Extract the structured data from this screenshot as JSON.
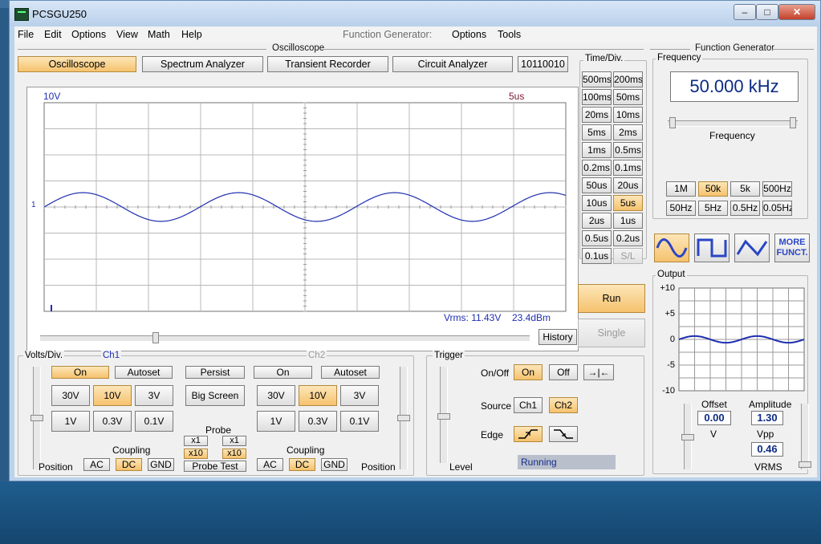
{
  "window": {
    "title": "PCSGU250"
  },
  "menu": {
    "file": "File",
    "edit": "Edit",
    "options": "Options",
    "view": "View",
    "math": "Math",
    "help": "Help",
    "fg_label": "Function Generator:",
    "fg_options": "Options",
    "fg_tools": "Tools"
  },
  "sections": {
    "oscilloscope": "Oscilloscope",
    "function_generator": "Function Generator"
  },
  "modes": {
    "oscilloscope": "Oscilloscope",
    "spectrum": "Spectrum Analyzer",
    "transient": "Transient Recorder",
    "circuit": "Circuit Analyzer",
    "binary": "10110010",
    "active": "Oscilloscope"
  },
  "scope": {
    "ch1_scale": "10V",
    "timebase": "5us",
    "marker": "1",
    "vrms": "Vrms: 11.43V",
    "dbm": "23.4dBm",
    "history": "History",
    "colors": {
      "trace": "#1f2fb0",
      "grid": "#b8b8b8"
    },
    "history_position": 0.23,
    "trace": {
      "cycles": 3.35,
      "amplitude_divs": 0.55,
      "offset_divs": 0
    }
  },
  "timediv": {
    "label": "Time/Div.",
    "buttons": [
      "500ms",
      "200ms",
      "100ms",
      "50ms",
      "20ms",
      "10ms",
      "5ms",
      "2ms",
      "1ms",
      "0.5ms",
      "0.2ms",
      "0.1ms",
      "50us",
      "20us",
      "10us",
      "5us",
      "2us",
      "1us",
      "0.5us",
      "0.2us",
      "0.1us",
      "S/L"
    ],
    "selected": "5us",
    "disabled": "S/L"
  },
  "run": {
    "run": "Run",
    "single": "Single"
  },
  "voltsdiv": {
    "label": "Volts/Div.",
    "ch1": "Ch1",
    "ch2": "Ch2",
    "ch1_on": "On",
    "ch1_autoset": "Autoset",
    "persist": "Persist",
    "big_screen": "Big Screen",
    "ch2_on": "On",
    "ch2_autoset": "Autoset",
    "ranges_row1": [
      "30V",
      "10V",
      "3V"
    ],
    "ranges_row2": [
      "1V",
      "0.3V",
      "0.1V"
    ],
    "ch1_selected": "10V",
    "ch2_selected": "10V",
    "probe": "Probe",
    "probe_x1": "x1",
    "probe_x10": "x10",
    "probe_test": "Probe Test",
    "coupling": "Coupling",
    "ac": "AC",
    "dc": "DC",
    "gnd": "GND",
    "position": "Position"
  },
  "trigger": {
    "label": "Trigger",
    "onoff": "On/Off",
    "on": "On",
    "off": "Off",
    "center": "→|←",
    "source": "Source",
    "ch1": "Ch1",
    "ch2": "Ch2",
    "edge": "Edge",
    "level": "Level",
    "status": "Running",
    "selected_onoff": "On",
    "selected_source": "Ch2",
    "selected_edge": "rising"
  },
  "fg": {
    "frequency_label": "Frequency",
    "frequency_value": "50.000 kHz",
    "slider_label": "Frequency",
    "range_row1": [
      "1M",
      "50k",
      "5k",
      "500Hz"
    ],
    "range_row2": [
      "50Hz",
      "5Hz",
      "0.5Hz",
      "0.05Hz"
    ],
    "selected_range": "50k",
    "more": "MORE FUNCT.",
    "selected_wave": "sine",
    "output": "Output",
    "y_ticks": [
      "+10",
      "+5",
      "0",
      "-5",
      "-10"
    ],
    "offset_label": "Offset",
    "offset_value": "0.00",
    "offset_unit": "V",
    "amplitude_label": "Amplitude",
    "amplitude_value": "1.30",
    "vpp": "Vpp",
    "vrms_value": "0.46",
    "vrms": "VRMS"
  }
}
